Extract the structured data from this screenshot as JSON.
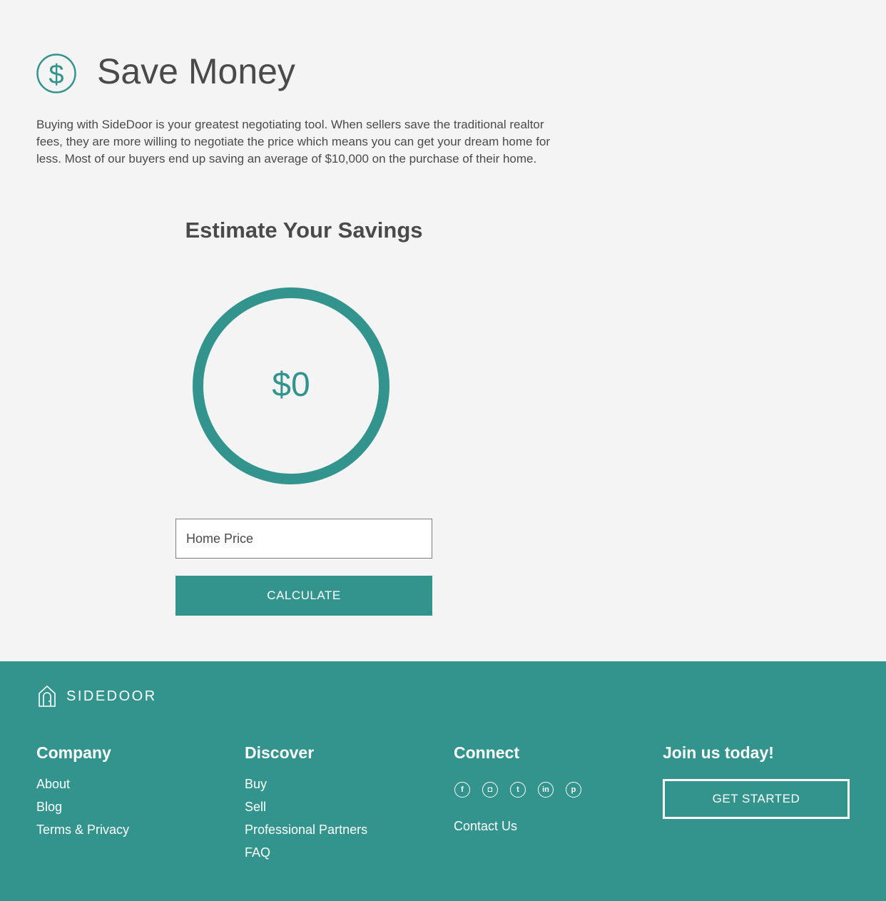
{
  "hero": {
    "title": "Save Money",
    "icon": "dollar-circle-icon",
    "intro": "Buying with SideDoor is your greatest negotiating tool. When sellers save the traditional realtor fees, they are more willing to negotiate the price which means you can get your dream home for less. Most of our buyers end up saving an average of $10,000 on the purchase of their home."
  },
  "calculator": {
    "title": "Estimate Your Savings",
    "savings_value": "$0",
    "home_price_placeholder": "Home Price",
    "home_price_value": "",
    "calculate_label": "CALCULATE"
  },
  "footer": {
    "logo_text": "SIDEDOOR",
    "company": {
      "title": "Company",
      "links": [
        "About",
        "Blog",
        "Terms & Privacy"
      ]
    },
    "discover": {
      "title": "Discover",
      "links": [
        "Buy",
        "Sell",
        "Professional Partners",
        "FAQ"
      ]
    },
    "connect": {
      "title": "Connect",
      "social": [
        {
          "name": "facebook-icon",
          "glyph": "f"
        },
        {
          "name": "instagram-icon",
          "glyph": "◘"
        },
        {
          "name": "twitter-icon",
          "glyph": "t"
        },
        {
          "name": "linkedin-icon",
          "glyph": "in"
        },
        {
          "name": "pinterest-icon",
          "glyph": "p"
        }
      ],
      "contact_label": "Contact Us"
    },
    "join": {
      "title": "Join us today!",
      "button_label": "GET STARTED"
    }
  },
  "colors": {
    "accent": "#33948e",
    "background": "#f4f4f4",
    "text": "#4a4a4a"
  }
}
